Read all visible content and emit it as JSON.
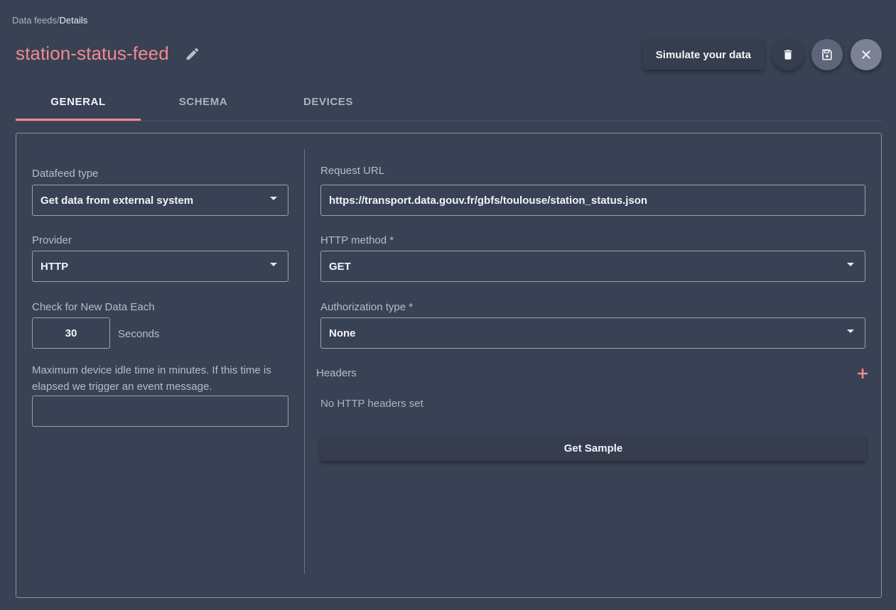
{
  "breadcrumb": {
    "parent": "Data feeds",
    "separator": "/",
    "current": "Details"
  },
  "title": "station-status-feed",
  "actions": {
    "simulate_label": "Simulate your data",
    "delete_icon": "trash-icon",
    "save_icon": "floppy-disk-icon",
    "close_icon": "close-icon"
  },
  "tabs": [
    {
      "label": "GENERAL",
      "active": true
    },
    {
      "label": "SCHEMA",
      "active": false
    },
    {
      "label": "DEVICES",
      "active": false
    }
  ],
  "left": {
    "datafeed_type": {
      "label": "Datafeed type",
      "value": "Get data from external system"
    },
    "provider": {
      "label": "Provider",
      "value": "HTTP"
    },
    "interval": {
      "label": "Check for New Data Each",
      "value": "30",
      "unit": "Seconds"
    },
    "idle_time": {
      "label": "Maximum device idle time in minutes. If this time is elapsed we trigger an event message.",
      "value": ""
    }
  },
  "right": {
    "request_url": {
      "label": "Request URL",
      "value": "https://transport.data.gouv.fr/gbfs/toulouse/station_status.json"
    },
    "http_method": {
      "label": "HTTP method *",
      "value": "GET"
    },
    "auth_type": {
      "label": "Authorization type *",
      "value": "None"
    },
    "headers": {
      "label": "Headers",
      "empty_text": "No HTTP headers set"
    },
    "sample_label": "Get Sample"
  },
  "colors": {
    "accent": "#f08a8c",
    "background": "#394154"
  }
}
